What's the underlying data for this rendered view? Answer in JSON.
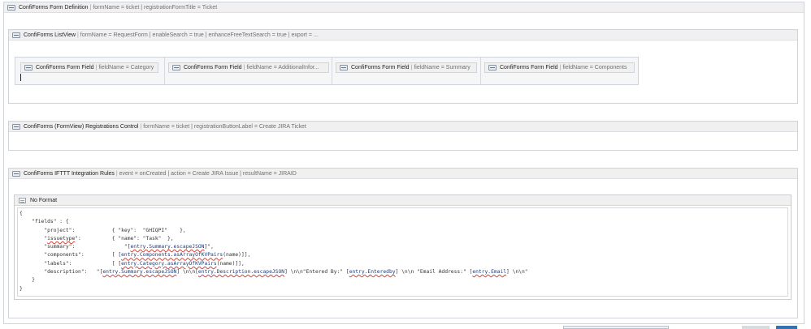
{
  "form_definition": {
    "title": "ConfiForms Form Definition",
    "params": "formName = ticket | registrationFormTitle = Ticket"
  },
  "listview": {
    "title": "ConfiForms ListView",
    "params": "formName = RequestForm | enableSearch = true | enhanceFreeTextSearch = true | export = ..."
  },
  "fields": [
    {
      "title": "ConfiForms Form Field",
      "params": "fieldName = Category"
    },
    {
      "title": "ConfiForms Form Field",
      "params": "fieldName = AdditionalInfor..."
    },
    {
      "title": "ConfiForms Form Field",
      "params": "fieldName = Summary"
    },
    {
      "title": "ConfiForms Form Field",
      "params": "fieldName = Components"
    }
  ],
  "registrations": {
    "title": "ConfiForms (FormView) Registrations Control",
    "params": "formName = ticket | registrationButtonLabel = Create JIRA Ticket"
  },
  "ifttt": {
    "title": "ConfiForms IFTTT Integration Rules",
    "params": "event = onCreated | action = Create JIRA Issue | resultName = JIRAID"
  },
  "noformat": {
    "title": "No Format",
    "code": {
      "l1": "{",
      "l2": "    \"fields\" : {",
      "l3a": "        \"project\":            { \"key\":  \"GHIQPI\"    },",
      "l4a": "        \"",
      "l4b": "issuetype",
      "l4c": "\":          { \"name\": \"Task\"  },",
      "l5a": "        \"summary\":                \"[",
      "l5b": "entry.Summary.escapeJSON",
      "l5c": "]\",",
      "l6a": "        \"components\":         [ [",
      "l6b": "entry.Components.asArrayOfKVPairs",
      "l6c": "(name)]],",
      "l7a": "        \"labels\":             [ [",
      "l7b": "entry.Category.asArrayOfKVPairs",
      "l7c": "(name)]],",
      "l8a": "        \"description\":   \"[",
      "l8b": "entry.Summary.escapeJSON",
      "l8c": "] \\n\\n[",
      "l8d": "entry.Description.escapeJSON",
      "l8e": "] \\n\\n\"Entered By:\" [",
      "l8f": "entry.Enteredby",
      "l8g": "] \\n\\n \"Email Address:\" [",
      "l8h": "entry.Email",
      "l8i": "] \\n\\n\"",
      "l9": "    }",
      "l10": "}"
    }
  }
}
